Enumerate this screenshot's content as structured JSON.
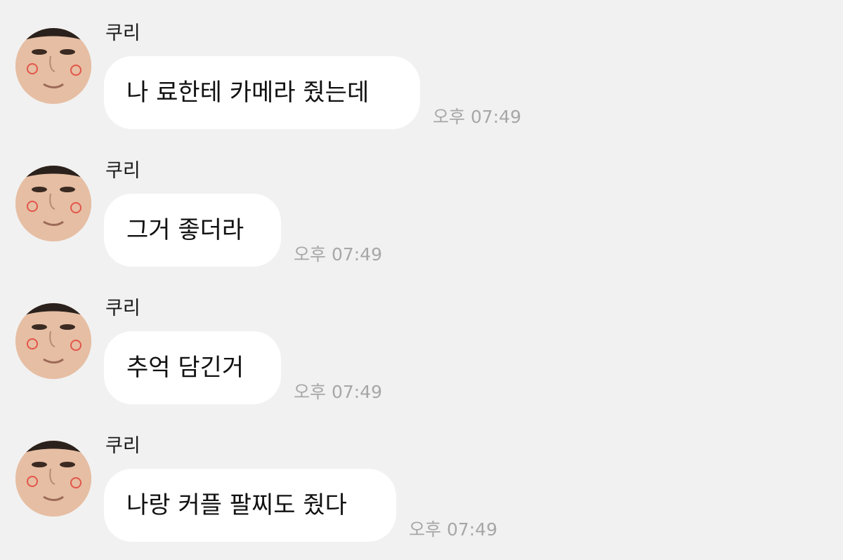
{
  "chat": {
    "messages": [
      {
        "sender": "쿠리",
        "text": "나 료한테 카메라 줬는데",
        "time": "오후 07:49"
      },
      {
        "sender": "쿠리",
        "text": "그거 좋더라",
        "time": "오후 07:49"
      },
      {
        "sender": "쿠리",
        "text": "추억 담긴거",
        "time": "오후 07:49"
      },
      {
        "sender": "쿠리",
        "text": "나랑 커플 팔찌도 줬다",
        "time": "오후 07:49"
      }
    ]
  },
  "colors": {
    "background": "#f1f1f1",
    "bubble": "#ffffff",
    "timestamp": "#a7a7a7"
  }
}
